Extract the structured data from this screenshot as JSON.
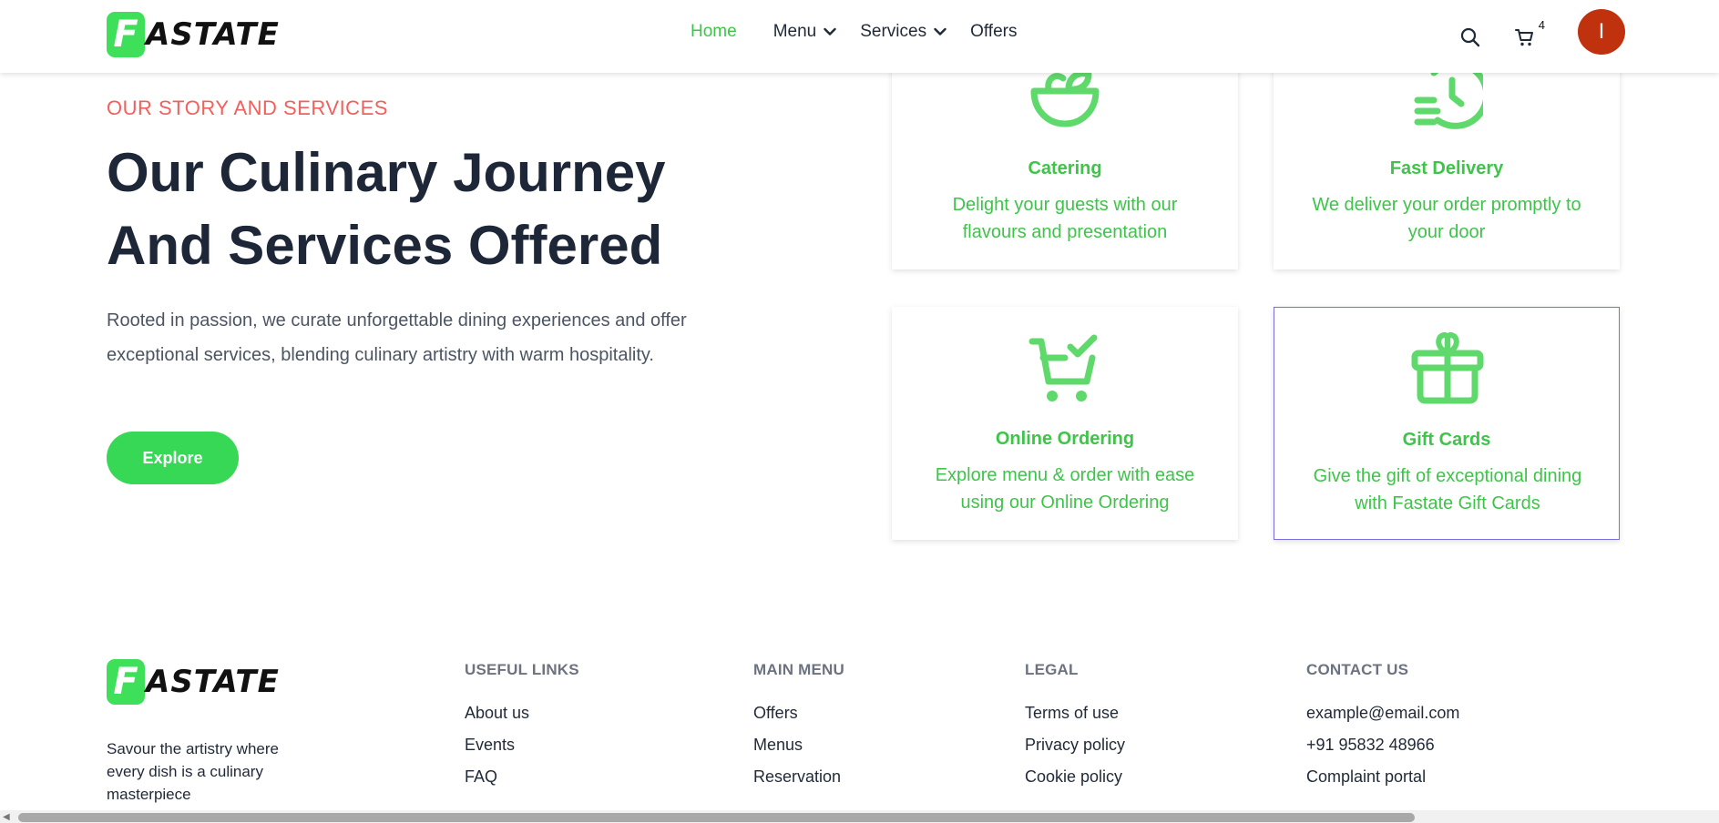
{
  "header": {
    "logo_letter": "F",
    "logo_text": "ASTATE",
    "nav": [
      {
        "label": "Home"
      },
      {
        "label": "Menu"
      },
      {
        "label": "Services"
      },
      {
        "label": "Offers"
      }
    ],
    "cart_count": "4",
    "avatar_initial": "I"
  },
  "hero": {
    "eyebrow": "OUR STORY AND SERVICES",
    "title_line1": "Our Culinary Journey",
    "title_line2": "And Services Offered",
    "text": "Rooted in passion, we curate unforgettable dining experiences and offer exceptional services, blending culinary artistry with warm hospitality.",
    "button": "Explore"
  },
  "services": [
    {
      "title": "Catering",
      "desc": "Delight your guests with our flavours and presentation",
      "icon": "salad-bowl-icon"
    },
    {
      "title": "Fast Delivery",
      "desc": "We deliver your order promptly to your door",
      "icon": "fast-clock-icon"
    },
    {
      "title": "Online Ordering",
      "desc": "Explore menu & order with ease using our Online Ordering",
      "icon": "cart-check-icon"
    },
    {
      "title": "Gift Cards",
      "desc": "Give the gift of exceptional dining with Fastate Gift Cards",
      "icon": "gift-icon"
    }
  ],
  "footer": {
    "tagline": "Savour the artistry where every dish is a culinary masterpiece",
    "columns": [
      {
        "heading": "USEFUL LINKS",
        "links": [
          "About us",
          "Events",
          "FAQ"
        ]
      },
      {
        "heading": "MAIN MENU",
        "links": [
          "Offers",
          "Menus",
          "Reservation"
        ]
      },
      {
        "heading": "LEGAL",
        "links": [
          "Terms of use",
          "Privacy policy",
          "Cookie policy"
        ]
      },
      {
        "heading": "CONTACT US",
        "links": [
          "example@email.com",
          "+91 95832 48966",
          "Complaint portal"
        ]
      }
    ]
  },
  "colors": {
    "brand_green": "#3ee05a",
    "accent_red": "#f0605d",
    "avatar_bg": "#c0310d"
  }
}
